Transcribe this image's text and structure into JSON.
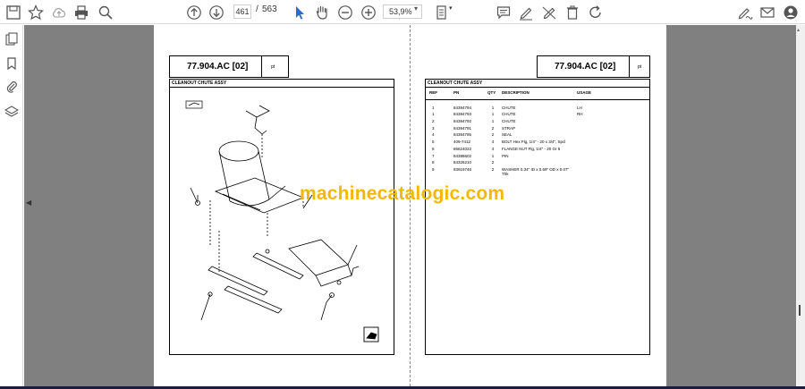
{
  "toolbar": {
    "current_page": "461",
    "page_separator": "/",
    "total_pages": "563",
    "zoom": "53,9%",
    "icons": [
      "save-icon",
      "bookmark-star-icon",
      "cloud-upload-icon",
      "print-icon",
      "zoom-search-icon",
      "page-up-icon",
      "page-down-icon",
      "select-arrow-icon",
      "hand-tool-icon",
      "zoom-out-icon",
      "zoom-in-icon",
      "fit-page-icon",
      "comment-icon",
      "highlight-pen-icon",
      "strike-pen-icon",
      "delete-icon",
      "rotate-icon",
      "sign-icon",
      "email-icon",
      "account-icon"
    ]
  },
  "sidebar": {
    "icons": [
      "pages-icon",
      "bookmark-icon",
      "attachment-icon",
      "layers-icon"
    ]
  },
  "document": {
    "left_title": "77.904.AC [02]",
    "right_title": "77.904.AC [02]",
    "pt_mark_left": "pt",
    "pt_mark_right": "pt",
    "left_section": "CLEANOUT CHUTE ASSY",
    "right_section": "CLEANOUT CHUTE ASSY",
    "headers": {
      "ref": "REF",
      "pn": "PN",
      "qty": "QTY",
      "description": "DESCRIPTION",
      "usage": "USAGE"
    },
    "rows": [
      {
        "ref": "1",
        "pn": "84394794",
        "qty": "1",
        "description": "CHUTE",
        "usage": "LH"
      },
      {
        "ref": "1",
        "pn": "84394793",
        "qty": "1",
        "description": "CHUTE",
        "usage": "RH"
      },
      {
        "ref": "2",
        "pn": "84394792",
        "qty": "1",
        "description": "CHUTE",
        "usage": ""
      },
      {
        "ref": "3",
        "pn": "84394791",
        "qty": "2",
        "description": "STRAP",
        "usage": ""
      },
      {
        "ref": "4",
        "pn": "84394795",
        "qty": "2",
        "description": "SEAL",
        "usage": ""
      },
      {
        "ref": "5",
        "pn": "409-7412",
        "qty": "4",
        "description": "BOLT Hex Flg, 1/4\" - 20 x 3/4\", Spcl",
        "usage": ""
      },
      {
        "ref": "6",
        "pn": "86624022",
        "qty": "4",
        "description": "FLANGE NUT Flg, 1/4\" - 20 Gr 5",
        "usage": ""
      },
      {
        "ref": "7",
        "pn": "84388602",
        "qty": "1",
        "description": "PIN",
        "usage": ""
      },
      {
        "ref": "8",
        "pn": "84326210",
        "qty": "2",
        "description": "",
        "usage": ""
      },
      {
        "ref": "9",
        "pn": "83919746",
        "qty": "2",
        "description": "WASHER 0.34\" ID x 0.69\" OD x 0.07\" Thk",
        "usage": ""
      }
    ]
  },
  "watermark": "machinecatalogic.com",
  "colors": {
    "viewer_bg": "#808080",
    "watermark": "#f5b800",
    "bottom_bar": "#1c1c3c"
  }
}
